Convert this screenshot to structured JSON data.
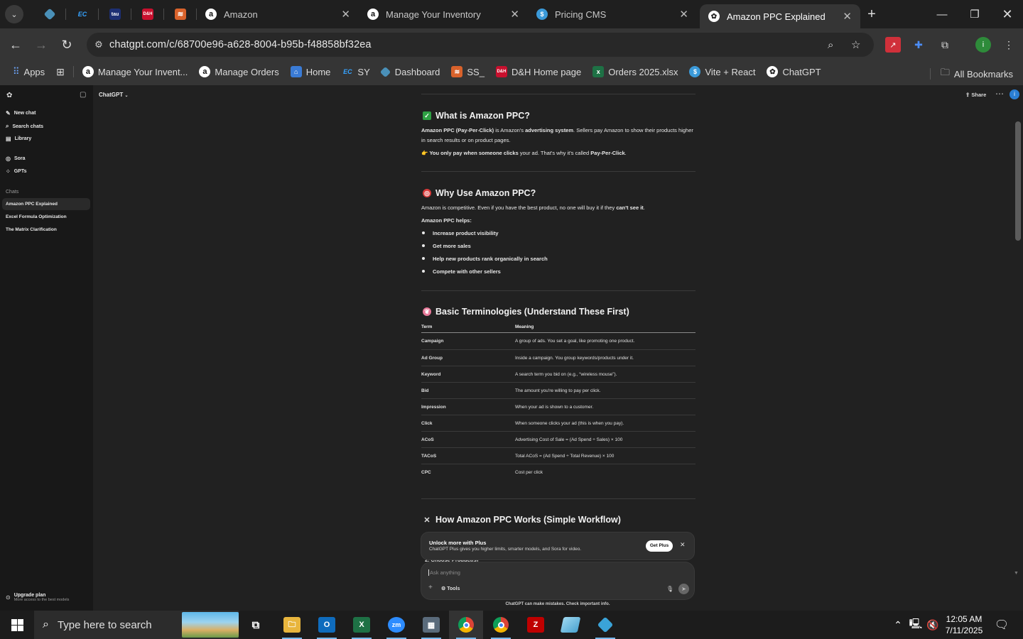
{
  "browser": {
    "pinned_tabs": [
      {
        "icon": "diamond-app-icon",
        "color": "#4a90b8"
      },
      {
        "icon": "ec-app-icon",
        "color": "#1e7bd6",
        "text": "EC"
      },
      {
        "icon": "tau-app-icon",
        "color": "#1d2f73",
        "text": "tau"
      },
      {
        "icon": "dh-app-icon",
        "color": "#c8102e",
        "text": "D&H"
      },
      {
        "icon": "stack-app-icon",
        "color": "#d9622b"
      }
    ],
    "tabs": [
      {
        "title": "Amazon",
        "icon": "amazon-icon",
        "active": false
      },
      {
        "title": "Manage Your Inventory",
        "icon": "amazon-icon",
        "active": false
      },
      {
        "title": "Pricing CMS",
        "icon": "dollar-icon",
        "active": false
      },
      {
        "title": "Amazon PPC Explained",
        "icon": "openai-icon",
        "active": true
      }
    ],
    "url": "chatgpt.com/c/68700e96-a628-8004-b95b-f48858bf32ea",
    "profile_initial": "i",
    "bookmarks": [
      {
        "label": "Apps",
        "icon": "apps-grid-icon"
      },
      {
        "label": "Manage Your Invent...",
        "icon": "amazon-icon"
      },
      {
        "label": "Manage Orders",
        "icon": "amazon-icon"
      },
      {
        "label": "Home",
        "icon": "home-app-icon"
      },
      {
        "label": "SY",
        "icon": "ec-app-icon"
      },
      {
        "label": "Dashboard",
        "icon": "diamond-app-icon"
      },
      {
        "label": "SS_",
        "icon": "stack-app-icon"
      },
      {
        "label": "D&H Home page",
        "icon": "dh-app-icon"
      },
      {
        "label": "Orders 2025.xlsx",
        "icon": "excel-icon"
      },
      {
        "label": "Vite + React",
        "icon": "dollar-icon"
      },
      {
        "label": "ChatGPT",
        "icon": "openai-icon"
      }
    ],
    "all_bookmarks": "All Bookmarks"
  },
  "sidebar": {
    "actions": [
      {
        "label": "New chat",
        "icon": "new-chat-icon"
      },
      {
        "label": "Search chats",
        "icon": "search-icon"
      },
      {
        "label": "Library",
        "icon": "library-icon"
      },
      {
        "label": "Sora",
        "icon": "sora-icon"
      },
      {
        "label": "GPTs",
        "icon": "gpts-icon"
      }
    ],
    "chats_heading": "Chats",
    "chats": [
      {
        "title": "Amazon PPC Explained",
        "selected": true
      },
      {
        "title": "Excel Formula Optimization",
        "selected": false
      },
      {
        "title": "The Matrix Clarification",
        "selected": false
      }
    ],
    "upgrade_title": "Upgrade plan",
    "upgrade_subtitle": "More access to the best models"
  },
  "header": {
    "model": "ChatGPT",
    "share": "Share",
    "avatar": "i"
  },
  "article": {
    "s1": {
      "title": "What is Amazon PPC?",
      "p1_bold": "Amazon PPC (Pay-Per-Click)",
      "p1_mid": " is Amazon's ",
      "p1_bold2": "advertising system",
      "p1_rest": ". Sellers pay Amazon to show their products higher in search results or on product pages.",
      "p2_emoji": "👉",
      "p2_bold": "You only pay when someone clicks",
      "p2_mid": " your ad. That's why it's called ",
      "p2_bold2": "Pay-Per-Click",
      "p2_end": "."
    },
    "s2": {
      "title": "Why Use Amazon PPC?",
      "p1": "Amazon is competitive. Even if you have the best product, no one will buy it if they ",
      "p1_bold": "can't see it",
      "p1_end": ".",
      "lead": "Amazon PPC helps:",
      "bullets": [
        "Increase product visibility",
        "Get more sales",
        "Help new products rank organically in search",
        "Compete with other sellers"
      ]
    },
    "s3": {
      "title": "Basic Terminologies (Understand These First)",
      "col_term": "Term",
      "col_meaning": "Meaning",
      "rows": [
        {
          "term": "Campaign",
          "meaning": "A group of ads. You set a goal, like promoting one product."
        },
        {
          "term": "Ad Group",
          "meaning": "Inside a campaign. You group keywords/products under it."
        },
        {
          "term": "Keyword",
          "meaning": "A search term you bid on (e.g., “wireless mouse”)."
        },
        {
          "term": "Bid",
          "meaning": "The amount you're willing to pay per click."
        },
        {
          "term": "Impression",
          "meaning": "When your ad is shown to a customer."
        },
        {
          "term": "Click",
          "meaning": "When someone clicks your ad (this is when you pay)."
        },
        {
          "term": "ACoS",
          "meaning": "Advertising Cost of Sale = (Ad Spend ÷ Sales) × 100"
        },
        {
          "term": "TACoS",
          "meaning": "Total ACoS = (Ad Spend ÷ Total Revenue) × 100"
        },
        {
          "term": "CPC",
          "meaning": "Cost per click"
        }
      ]
    },
    "s4": {
      "title": "How Amazon PPC Works (Simple Workflow)",
      "partial_item": "2. Choose Product(s)"
    }
  },
  "promo": {
    "title": "Unlock more with Plus",
    "subtitle": "ChatGPT Plus gives you higher limits, smarter models, and Sora for video.",
    "button": "Get Plus"
  },
  "composer": {
    "placeholder": "Ask anything",
    "tools": "Tools"
  },
  "disclaimer": "ChatGPT can make mistakes. Check important info.",
  "taskbar": {
    "search_placeholder": "Type here to search",
    "time": "12:05 AM",
    "date": "7/11/2025"
  }
}
